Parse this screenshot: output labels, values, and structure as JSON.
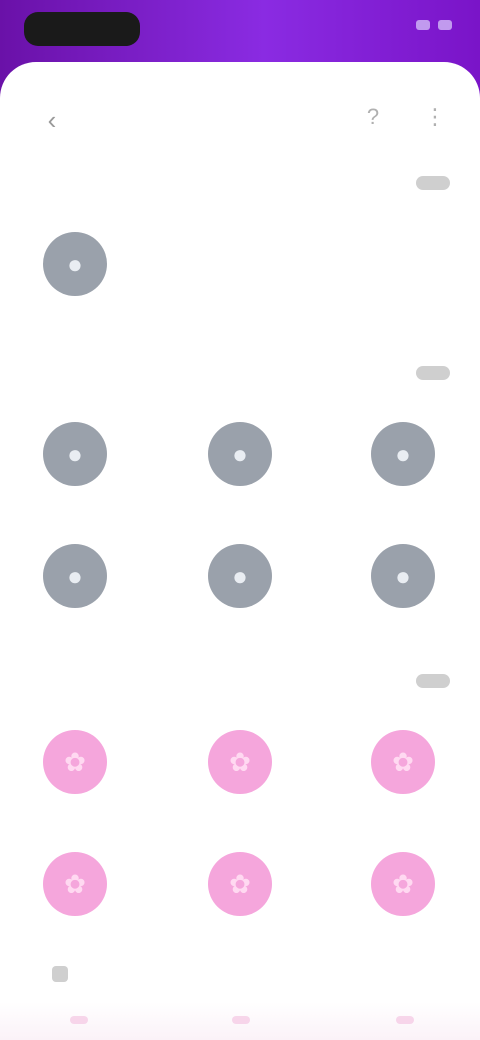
{
  "status": {
    "left_text": "",
    "right_text": ""
  },
  "nav": {
    "title": "",
    "back_icon": "chevron-left-icon",
    "right_icons": [
      "help-icon",
      "more-icon"
    ]
  },
  "sections": [
    {
      "title": "",
      "action": "",
      "tiles": [
        {
          "label": "",
          "icon": "avatar-icon",
          "color": "#9aa1ab"
        }
      ]
    },
    {
      "title": "",
      "action": "",
      "tiles": [
        {
          "label": "",
          "icon": "app-icon",
          "color": "#9aa1ab"
        },
        {
          "label": "",
          "icon": "app-icon",
          "color": "#9aa1ab"
        },
        {
          "label": "",
          "icon": "app-icon",
          "color": "#9aa1ab"
        },
        {
          "label": "",
          "icon": "app-icon",
          "color": "#9aa1ab"
        },
        {
          "label": "",
          "icon": "app-icon",
          "color": "#9aa1ab"
        },
        {
          "label": "",
          "icon": "app-icon",
          "color": "#9aa1ab"
        }
      ]
    },
    {
      "title": "",
      "action": "",
      "tiles": [
        {
          "label": "",
          "icon": "flower-icon",
          "color": "#f5a6dc"
        },
        {
          "label": "",
          "icon": "flower-icon",
          "color": "#f5a6dc"
        },
        {
          "label": "",
          "icon": "flower-icon",
          "color": "#f5a6dc"
        },
        {
          "label": "",
          "icon": "flower-icon",
          "color": "#f5a6dc"
        },
        {
          "label": "",
          "icon": "flower-icon",
          "color": "#f5a6dc"
        },
        {
          "label": "",
          "icon": "flower-icon",
          "color": "#f5a6dc"
        }
      ]
    }
  ],
  "footer": {
    "note": ""
  },
  "colors": {
    "accent_purple": "#8a2be2",
    "gray_icon": "#9aa1ab",
    "pink_icon": "#f5a6dc"
  }
}
